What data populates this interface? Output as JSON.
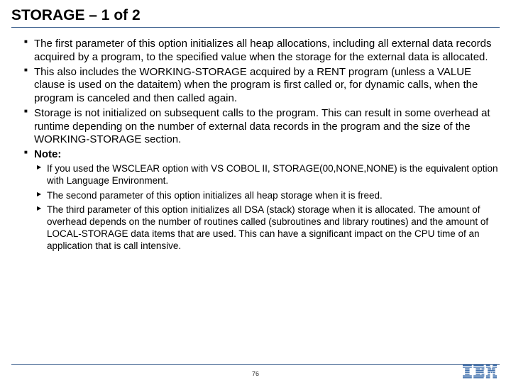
{
  "title": "STORAGE – 1 of 2",
  "bullets": [
    "The first parameter of this option initializes all heap allocations, including all external data records acquired by a program, to the specified value when the storage for the external data is allocated.",
    "This also includes the WORKING-STORAGE acquired by a RENT program (unless a VALUE clause is used on the dataitem) when the program is first called or, for dynamic calls, when the program is canceled and then called again.",
    "Storage is not initialized on subsequent calls to the program. This can result in some overhead at runtime depending on the number of external data records in the program and the size of the WORKING-STORAGE section."
  ],
  "note_label": "Note:",
  "note_items": [
    "If you used the WSCLEAR option with VS COBOL II, STORAGE(00,NONE,NONE) is the equivalent option with Language Environment.",
    "The second parameter of this option initializes all heap storage when it is freed.",
    "The third parameter of this option initializes all DSA (stack) storage when it is allocated. The amount of overhead depends on the number of routines called (subroutines and library routines) and the amount of LOCAL-STORAGE data items that are used. This can have a significant impact on the CPU time of an application that is call intensive."
  ],
  "page_number": "76",
  "logo_name": "IBM"
}
